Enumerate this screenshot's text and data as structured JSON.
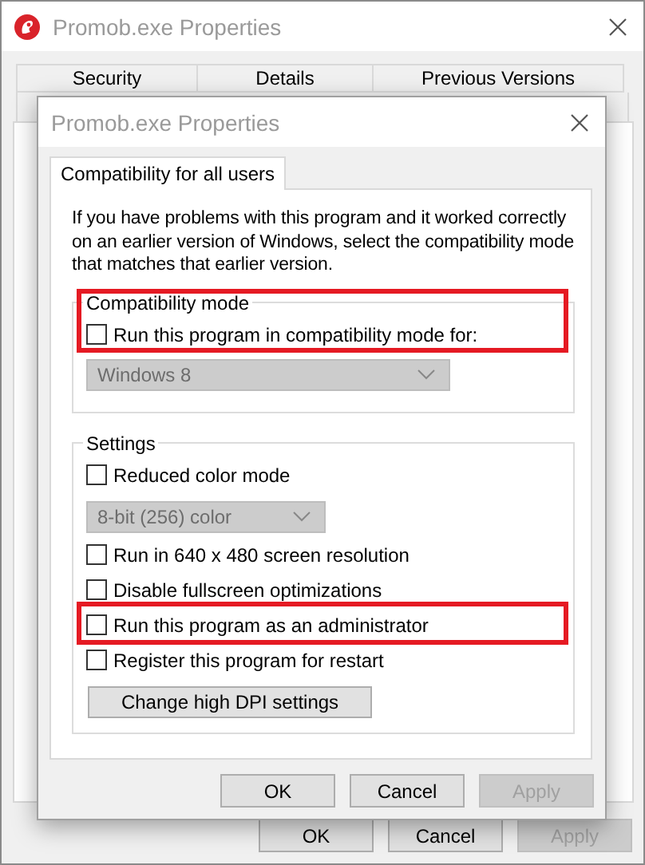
{
  "background_window": {
    "title": "Promob.exe Properties",
    "tabs": [
      {
        "label": "Security",
        "selected": false
      },
      {
        "label": "Details",
        "selected": false
      },
      {
        "label": "Previous Versions",
        "selected": false
      }
    ],
    "buttons": [
      {
        "label": "OK",
        "disabled": false
      },
      {
        "label": "Cancel",
        "disabled": false
      },
      {
        "label": "Apply",
        "disabled": true
      }
    ]
  },
  "dialog": {
    "title": "Promob.exe Properties",
    "tabs": [
      {
        "label": "Compatibility for all users",
        "selected": true
      }
    ],
    "intro": "If you have problems with this program and it worked correctly on an earlier version of Windows, select the compatibility mode that matches that earlier version.",
    "compatibility_mode": {
      "title": "Compatibility mode",
      "option": {
        "label": "Run this program in compatibility mode for:",
        "checked": false,
        "highlighted": true
      },
      "dropdown": {
        "value": "Windows 8",
        "disabled": true
      }
    },
    "settings": {
      "title": "Settings",
      "items": [
        {
          "kind": "checkbox",
          "label": "Reduced color mode",
          "checked": false,
          "highlighted": false
        },
        {
          "kind": "dropdown",
          "value": "8-bit (256) color",
          "disabled": true
        },
        {
          "kind": "checkbox",
          "label": "Run in 640 x 480 screen resolution",
          "checked": false,
          "highlighted": false
        },
        {
          "kind": "checkbox",
          "label": "Disable fullscreen optimizations",
          "checked": false,
          "highlighted": false
        },
        {
          "kind": "checkbox",
          "label": "Run this program as an administrator",
          "checked": false,
          "highlighted": true
        },
        {
          "kind": "checkbox",
          "label": "Register this program for restart",
          "checked": false,
          "highlighted": false
        },
        {
          "kind": "button",
          "label": "Change high DPI settings",
          "disabled": false
        }
      ]
    },
    "buttons": [
      {
        "label": "OK",
        "disabled": false
      },
      {
        "label": "Cancel",
        "disabled": false
      },
      {
        "label": "Apply",
        "disabled": true
      }
    ]
  }
}
